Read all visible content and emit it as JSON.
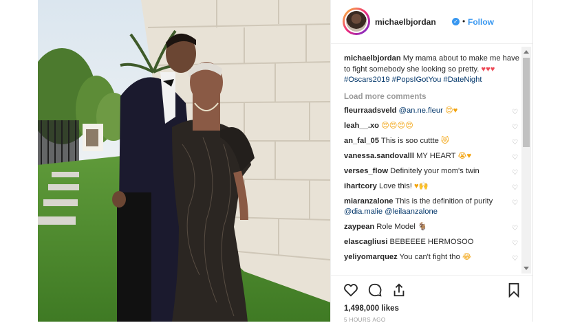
{
  "post": {
    "username": "michaelbjordan",
    "verified_badge": "verified-badge-icon",
    "separator": "•",
    "follow_label": "Follow"
  },
  "caption": {
    "username": "michaelbjordan",
    "text": "My mama about to make me have to fight somebody she looking so pretty.",
    "emojis": "♥♥♥",
    "hashtags": "#Oscars2019 #PopsIGotYou #DateNight"
  },
  "load_more": "Load more comments",
  "comments": [
    {
      "user": "fleurraadsveld",
      "text": "",
      "mention": "@an.ne.fleur",
      "after": "",
      "emoji": "😍♥"
    },
    {
      "user": "leah__.xo",
      "text": "",
      "mention": "",
      "after": "",
      "emoji": "😍😍😍😍"
    },
    {
      "user": "an_fal_05",
      "text": "This is soo cuttte",
      "mention": "",
      "after": "",
      "emoji": "😻"
    },
    {
      "user": "vanessa.sandovalll",
      "text": "MY HEART",
      "mention": "",
      "after": "",
      "emoji": "😭♥"
    },
    {
      "user": "verses_flow",
      "text": "Definitely your mom's twin",
      "mention": "",
      "after": "",
      "emoji": ""
    },
    {
      "user": "ihartcory",
      "text": "Love this!",
      "mention": "",
      "after": "",
      "emoji": "♥🙌"
    },
    {
      "user": "miaranzalone",
      "text": "This is the definition of purity",
      "mention": "@dia.malie",
      "after": "@leilaanzalone",
      "emoji": ""
    },
    {
      "user": "zaypean",
      "text": "Role Model",
      "mention": "",
      "after": "",
      "emoji": "🐐"
    },
    {
      "user": "elascagliusi",
      "text": "BEBEEEE HERMOSOO",
      "mention": "",
      "after": "",
      "emoji": ""
    },
    {
      "user": "yeliyomarquez",
      "text": "You can't fight tho",
      "mention": "",
      "after": "",
      "emoji": "😂"
    }
  ],
  "likes": "1,498,000 likes",
  "time_ago": "5 HOURS AGO",
  "colors": {
    "link": "#3897f0",
    "heart": "#ed4956",
    "text": "#262626",
    "muted": "#999999"
  }
}
